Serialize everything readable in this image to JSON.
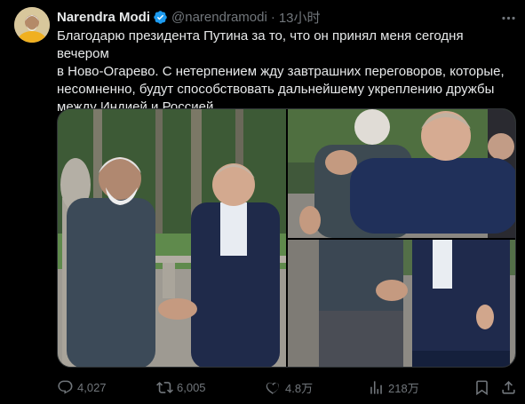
{
  "author": {
    "name": "Narendra Modi",
    "handle": "@narendramodi",
    "separator": "·",
    "time": "13小时"
  },
  "tweet": {
    "lines": [
      "Благодарю президента Путина за то, что он принял меня сегодня вечером",
      "в Ново-Огарево. С нетерпением жду завтрашних переговоров, которые,",
      "несомненно, будут способствовать дальнейшему укреплению дружбы",
      "между Индией и Россией."
    ]
  },
  "media": {
    "images": [
      {
        "name": "photo-handshake"
      },
      {
        "name": "photo-hug-top"
      },
      {
        "name": "photo-handshake-closeup"
      }
    ]
  },
  "actions": {
    "reply_count": "4,027",
    "repost_count": "6,005",
    "like_count": "4.8万",
    "views_count": "218万"
  },
  "colors": {
    "background": "#000000",
    "text": "#e7e9ea",
    "muted": "#71767b",
    "verified": "#1d9bf0",
    "border": "#2f3336"
  },
  "icons": [
    "verified-badge-icon",
    "more-icon",
    "reply-icon",
    "repost-icon",
    "like-icon",
    "views-icon",
    "bookmark-icon",
    "share-icon"
  ]
}
